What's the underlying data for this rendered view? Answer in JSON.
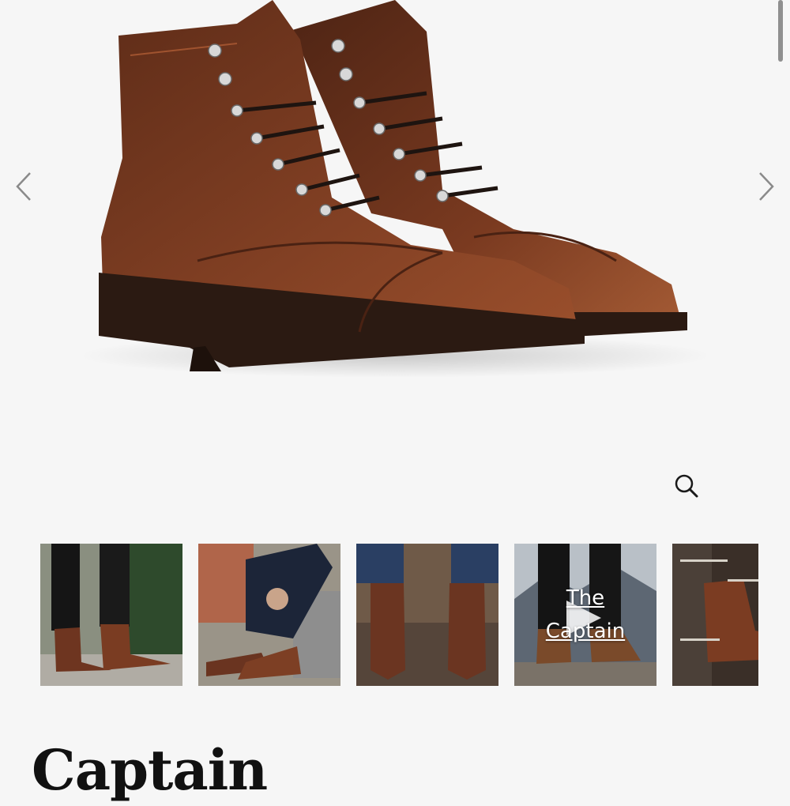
{
  "product": {
    "title": "Captain",
    "image_alt": "Brown leather cap-toe lace-up boots"
  },
  "gallery": {
    "prev_icon": "chevron-left-icon",
    "next_icon": "chevron-right-icon",
    "zoom_icon": "magnifier-icon",
    "thumbnails": [
      {
        "type": "image",
        "alt": "Boots worn outdoors"
      },
      {
        "type": "image",
        "alt": "Lacing boots on bench"
      },
      {
        "type": "image",
        "alt": "Boots on wooden deck"
      },
      {
        "type": "video",
        "label_line1": "The",
        "label_line2": "Captain",
        "icon": "play-icon"
      },
      {
        "type": "image",
        "alt": "Boot feature callouts"
      }
    ]
  },
  "colors": {
    "background": "#f6f6f6",
    "leather": "#7a3a20",
    "sole": "#2b1a12",
    "title": "#111111"
  }
}
